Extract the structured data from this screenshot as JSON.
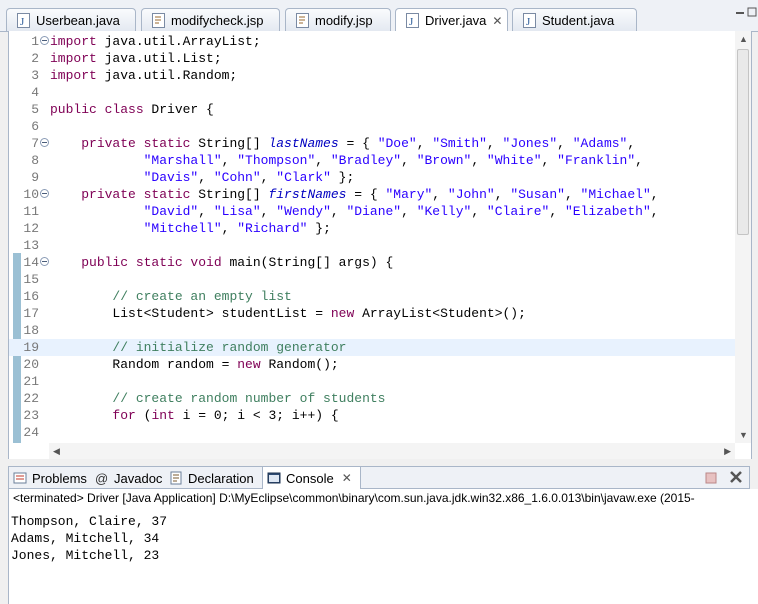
{
  "editor_tabs": [
    {
      "label": "Userbean.java",
      "type": "java"
    },
    {
      "label": "modifycheck.jsp",
      "type": "jsp"
    },
    {
      "label": "modify.jsp",
      "type": "jsp"
    },
    {
      "label": "Driver.java",
      "type": "java",
      "active": true,
      "close": "✕"
    },
    {
      "label": "Student.java",
      "type": "java"
    }
  ],
  "code": {
    "line_numbers": [
      "1",
      "2",
      "3",
      "4",
      "5",
      "6",
      "7",
      "8",
      "9",
      "10",
      "11",
      "12",
      "13",
      "14",
      "15",
      "16",
      "17",
      "18",
      "19",
      "20",
      "21",
      "22",
      "23",
      "24"
    ],
    "lines": {
      "l1_kw": "import",
      "l1_rest": " java.util.ArrayList;",
      "l2_kw": "import",
      "l2_rest": " java.util.List;",
      "l3_kw": "import",
      "l3_rest": " java.util.Random;",
      "l5_kw": "public class",
      "l5_rest": " Driver {",
      "l7_kw": "private static",
      "l7_type": " String[] ",
      "l7_field": "lastNames",
      "l7_eq": " = { ",
      "l7_s1": "\"Doe\"",
      "l7_s2": "\"Smith\"",
      "l7_s3": "\"Jones\"",
      "l7_s4": "\"Adams\"",
      "l8_s1": "\"Marshall\"",
      "l8_s2": "\"Thompson\"",
      "l8_s3": "\"Bradley\"",
      "l8_s4": "\"Brown\"",
      "l8_s5": "\"White\"",
      "l8_s6": "\"Franklin\"",
      "l9_s1": "\"Davis\"",
      "l9_s2": "\"Cohn\"",
      "l9_s3": "\"Clark\"",
      "l9_end": " };",
      "l10_kw": "private static",
      "l10_type": " String[] ",
      "l10_field": "firstNames",
      "l10_eq": " = { ",
      "l10_s1": "\"Mary\"",
      "l10_s2": "\"John\"",
      "l10_s3": "\"Susan\"",
      "l10_s4": "\"Michael\"",
      "l11_s1": "\"David\"",
      "l11_s2": "\"Lisa\"",
      "l11_s3": "\"Wendy\"",
      "l11_s4": "\"Diane\"",
      "l11_s5": "\"Kelly\"",
      "l11_s6": "\"Claire\"",
      "l11_s7": "\"Elizabeth\"",
      "l12_s1": "\"Mitchell\"",
      "l12_s2": "\"Richard\"",
      "l12_end": " };",
      "l14_kw": "public static void",
      "l14_rest": " main(String[] args) {",
      "l16_cmt": "// create an empty list",
      "l17_a": "List<Student> studentList = ",
      "l17_kw": "new",
      "l17_b": " ArrayList<Student>();",
      "l19_cmt": "// initialize random generator",
      "l20_a": "Random random = ",
      "l20_kw": "new",
      "l20_b": " Random();",
      "l22_cmt": "// create random number of students",
      "l23_kw1": "for",
      "l23_a": " (",
      "l23_kw2": "int",
      "l23_b": " i = 0; i < 3; i++) {"
    }
  },
  "view_tabs": [
    {
      "label": "Problems"
    },
    {
      "label": "Javadoc"
    },
    {
      "label": "Declaration"
    },
    {
      "label": "Console",
      "active": true,
      "close": "✕"
    }
  ],
  "console": {
    "header": "<terminated> Driver [Java Application] D:\\MyEclipse\\common\\binary\\com.sun.java.jdk.win32.x86_1.6.0.013\\bin\\javaw.exe (2015-",
    "output": [
      "Thompson, Claire, 37",
      "Adams, Mitchell, 34",
      "Jones, Mitchell, 23"
    ]
  },
  "colors": {
    "keyword": "#7f0055",
    "string": "#2a00ff",
    "comment": "#3f7f5f",
    "field": "#0000c0"
  }
}
